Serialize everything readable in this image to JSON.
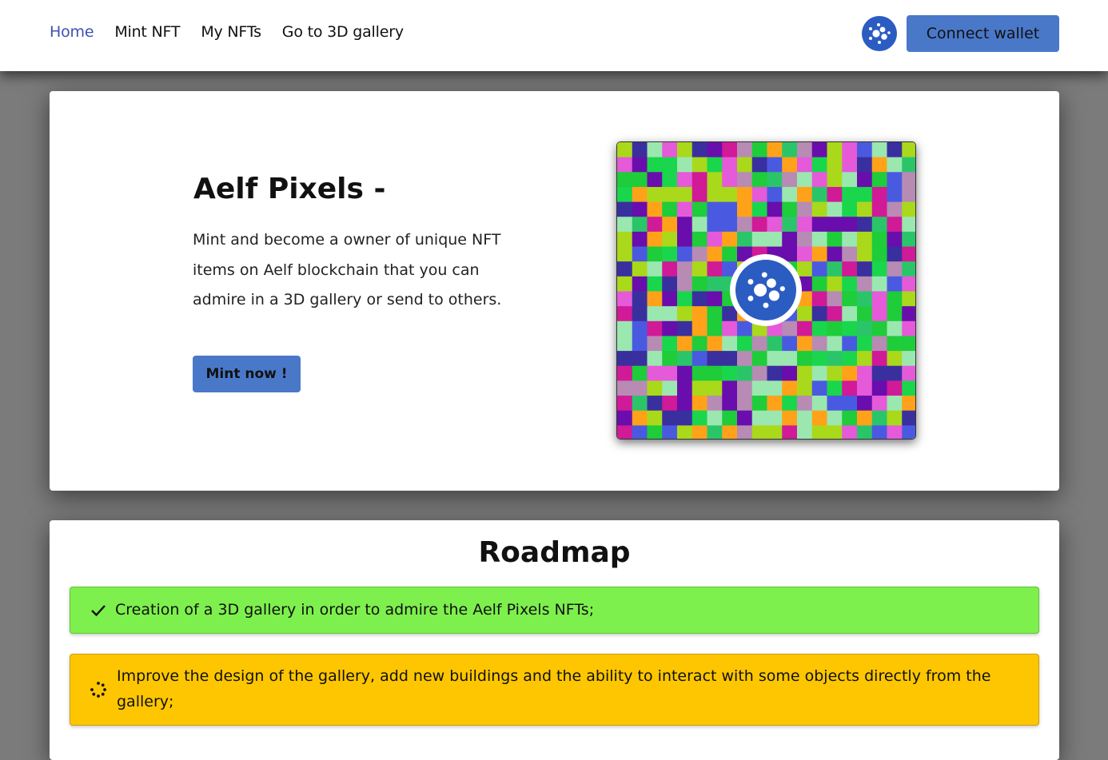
{
  "nav": {
    "links": [
      {
        "label": "Home",
        "active": true
      },
      {
        "label": "Mint NFT",
        "active": false
      },
      {
        "label": "My NFTs",
        "active": false
      },
      {
        "label": "Go to 3D gallery",
        "active": false
      }
    ],
    "logo_icon": "aelf-logo-icon",
    "connect_label": "Connect wallet"
  },
  "hero": {
    "title": "Aelf Pixels -",
    "description": "Mint and become a owner of unique NFT items on Aelf blockchain that you can admire in a 3D gallery or send to others.",
    "mint_label": "Mint now !",
    "image_icon": "aelf-logo-icon",
    "pixel_palette": [
      "#6a0dad",
      "#9be7b0",
      "#e55ad9",
      "#ffa21a",
      "#1fcc3a",
      "#a9d91a",
      "#3a2f9f",
      "#b78bb4",
      "#4a5ae0",
      "#2bc569",
      "#d01a98",
      "#1ad64c"
    ]
  },
  "roadmap": {
    "title": "Roadmap",
    "items": [
      {
        "status": "done",
        "icon": "check-icon",
        "color": "#7ef04d",
        "text": "Creation of a 3D gallery in order to admire the Aelf Pixels NFTs;"
      },
      {
        "status": "in-progress",
        "icon": "loading-spinner-icon",
        "color": "#fec600",
        "text": "Improve the design of the gallery, add new buildings and the ability to interact with some objects directly from the gallery;"
      }
    ]
  },
  "colors": {
    "accent": "#3f51b5",
    "button": "#4a78c9",
    "logo_blue": "#2b5cc2"
  }
}
